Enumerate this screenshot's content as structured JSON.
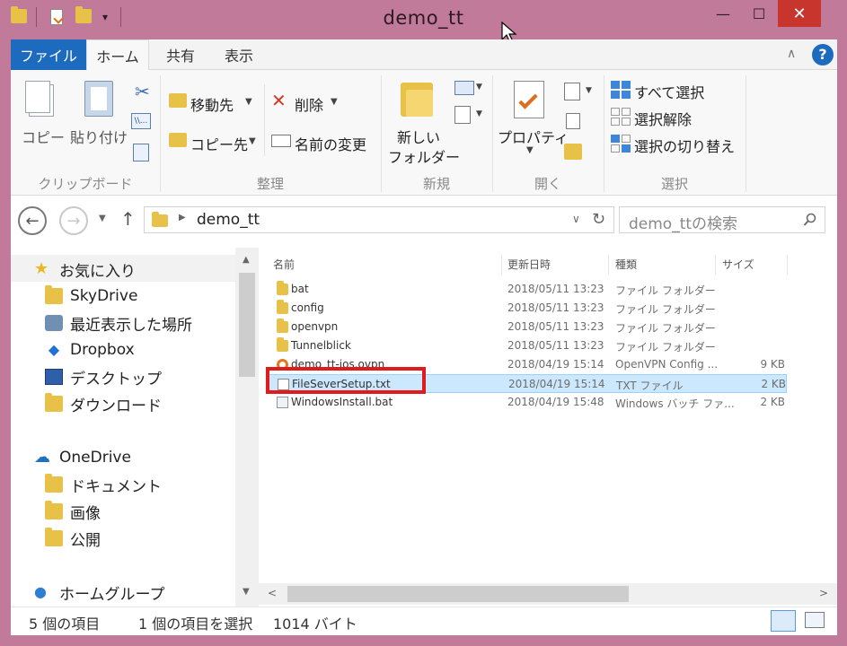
{
  "window": {
    "title": "demo_tt",
    "minimize": "—",
    "maximize": "☐",
    "close": "✕"
  },
  "ribbon": {
    "tabs": [
      "ファイル",
      "ホーム",
      "共有",
      "表示"
    ],
    "clipboard": {
      "copy": "コピー",
      "paste": "貼り付け",
      "label": "クリップボード"
    },
    "organize": {
      "move_to": "移動先",
      "copy_to": "コピー先",
      "delete": "削除",
      "rename": "名前の変更",
      "label": "整理"
    },
    "new": {
      "new_folder_line1": "新しい",
      "new_folder_line2": "フォルダー",
      "label": "新規"
    },
    "open": {
      "properties": "プロパティ",
      "label": "開く"
    },
    "select": {
      "select_all": "すべて選択",
      "select_none": "選択解除",
      "invert": "選択の切り替え",
      "label": "選択"
    }
  },
  "navbar": {
    "path": "demo_tt",
    "search_placeholder": "demo_ttの検索"
  },
  "sidebar": {
    "items": [
      {
        "label": "お気に入り",
        "icon": "star-icon"
      },
      {
        "label": "SkyDrive",
        "icon": "folder-icon"
      },
      {
        "label": "最近表示した場所",
        "icon": "recent-places-icon"
      },
      {
        "label": "Dropbox",
        "icon": "dropbox-icon"
      },
      {
        "label": "デスクトップ",
        "icon": "desktop-icon"
      },
      {
        "label": "ダウンロード",
        "icon": "downloads-icon"
      },
      {
        "label": "OneDrive",
        "icon": "cloud-icon"
      },
      {
        "label": "ドキュメント",
        "icon": "folder-icon"
      },
      {
        "label": "画像",
        "icon": "folder-icon"
      },
      {
        "label": "公開",
        "icon": "folder-icon"
      },
      {
        "label": "ホームグループ",
        "icon": "homegroup-icon"
      }
    ]
  },
  "filelist": {
    "headers": {
      "name": "名前",
      "date": "更新日時",
      "type": "種類",
      "size": "サイズ"
    },
    "rows": [
      {
        "name": "bat",
        "date": "2018/05/11 13:23",
        "type": "ファイル フォルダー",
        "size": "",
        "icon": "folder-icon"
      },
      {
        "name": "config",
        "date": "2018/05/11 13:23",
        "type": "ファイル フォルダー",
        "size": "",
        "icon": "folder-icon"
      },
      {
        "name": "openvpn",
        "date": "2018/05/11 13:23",
        "type": "ファイル フォルダー",
        "size": "",
        "icon": "folder-icon"
      },
      {
        "name": "Tunnelblick",
        "date": "2018/05/11 13:23",
        "type": "ファイル フォルダー",
        "size": "",
        "icon": "folder-icon"
      },
      {
        "name": "demo_tt-ios.ovpn",
        "date": "2018/04/19 15:14",
        "type": "OpenVPN Config ...",
        "size": "9 KB",
        "icon": "openvpn-icon"
      },
      {
        "name": "FileSeverSetup.txt",
        "date": "2018/04/19 15:14",
        "type": "TXT ファイル",
        "size": "2 KB",
        "icon": "text-file-icon"
      },
      {
        "name": "WindowsInstall.bat",
        "date": "2018/04/19 15:48",
        "type": "Windows バッチ ファ...",
        "size": "2 KB",
        "icon": "batch-file-icon"
      }
    ]
  },
  "status": {
    "count": "5 個の項目",
    "selection": "1 個の項目を選択",
    "bytes": "1014 バイト"
  },
  "colors": {
    "titlebar": "#c27a9b",
    "file_tab": "#1c6bbf",
    "selection": "#cce8ff",
    "highlight": "#e01b1b",
    "close_button": "#c7352c"
  }
}
